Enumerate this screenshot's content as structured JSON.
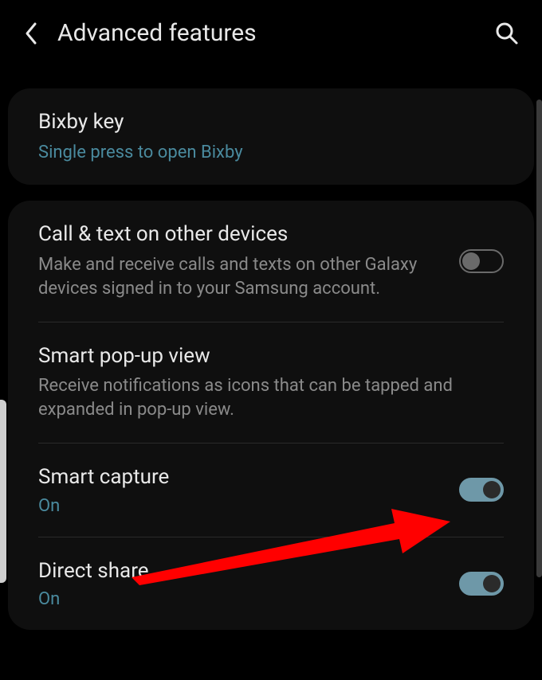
{
  "header": {
    "title": "Advanced features"
  },
  "card1": {
    "item1": {
      "title": "Bixby key",
      "subtitle": "Single press to open Bixby"
    }
  },
  "card2": {
    "item1": {
      "title": "Call & text on other devices",
      "subtitle": "Make and receive calls and texts on other Galaxy devices signed in to your Samsung account."
    },
    "item2": {
      "title": "Smart pop-up view",
      "subtitle": "Receive notifications as icons that can be tapped and expanded in pop-up view."
    },
    "item3": {
      "title": "Smart capture",
      "status": "On"
    },
    "item4": {
      "title": "Direct share",
      "status": "On"
    }
  }
}
